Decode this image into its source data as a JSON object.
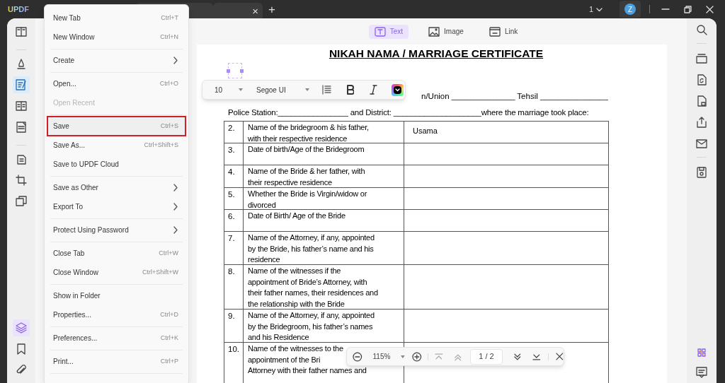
{
  "title_bar": {
    "logo": "UPDF",
    "tab_close": "×",
    "new_tab": "+",
    "page_count": "1",
    "avatar": "Z"
  },
  "left_tools": [
    {
      "selected": false
    },
    {
      "selected": false
    },
    {
      "selected": true
    },
    {
      "selected": false
    },
    {
      "selected": false
    },
    {
      "selected": false
    },
    {
      "selected": false
    },
    {
      "selected": false
    }
  ],
  "bottom_tools": [
    {
      "selected": true
    },
    {
      "selected": false
    },
    {
      "selected": false
    }
  ],
  "mode_tabs": [
    {
      "label": "Text",
      "selected": true
    },
    {
      "label": "Image",
      "selected": false
    },
    {
      "label": "Link",
      "selected": false
    }
  ],
  "document": {
    "title": "NIKAH NAMA / MARRIAGE CERTIFICATE",
    "partial_line": "n/Union ______________ Tehsil _______________",
    "police_line": "Police Station:________________ and District: ____________________where the marriage took place:",
    "rows": [
      {
        "number": "2.",
        "label_lines": [
          "Name of the bridegroom & his father,",
          "with their respective residence"
        ],
        "value": "Usama"
      },
      {
        "number": "3.",
        "label_lines": [
          "Date of birth/Age of the Bridegroom"
        ]
      },
      {
        "number": "4.",
        "label_lines": [
          "Name of  the Bride & her father, with",
          "their respective residence"
        ]
      },
      {
        "number": "5.",
        "label_lines": [
          "Whether the Bride is Virgin/widow or",
          "divorced"
        ]
      },
      {
        "number": "6.",
        "label_lines": [
          "Date of Birth/ Age of the Bride"
        ]
      },
      {
        "number": "7.",
        "label_lines": [
          "Name of  the Attorney, if any, appointed",
          "by the Bride, his father’s name and his",
          "residence"
        ]
      },
      {
        "number": "8.",
        "label_lines": [
          "Name of the witnesses if the",
          "appointment of Bride’s Attorney, with",
          "their father  names, their residences and",
          "the relationship with the Bride"
        ]
      },
      {
        "number": "9.",
        "label_lines": [
          "Name of the Attorney, if any, appointed",
          "by the  Bridegroom, his father’s names",
          "and his Residence"
        ]
      },
      {
        "number": "10.",
        "label_lines": [
          "Name of the witnesses to the",
          "appointment  of the Bri",
          "Attorney with their father names and"
        ]
      }
    ]
  },
  "text_toolbar": {
    "font_size": "10",
    "font": "Segoe UI"
  },
  "file_menu": {
    "entries": [
      {
        "kind": "item",
        "label": "New Tab",
        "shortcut": "Ctrl+T",
        "submenu": false,
        "disabled": false,
        "selected": false
      },
      {
        "kind": "item",
        "label": "New Window",
        "shortcut": "Ctrl+N",
        "submenu": false,
        "disabled": false,
        "selected": false
      },
      {
        "kind": "separator"
      },
      {
        "kind": "item",
        "label": "Create",
        "submenu": true,
        "disabled": false,
        "selected": false
      },
      {
        "kind": "separator"
      },
      {
        "kind": "item",
        "label": "Open...",
        "shortcut": "Ctrl+O",
        "submenu": false,
        "disabled": false,
        "selected": false
      },
      {
        "kind": "item",
        "label": "Open Recent",
        "submenu": false,
        "disabled": true,
        "selected": false
      },
      {
        "kind": "separator"
      },
      {
        "kind": "item",
        "label": "Save",
        "shortcut": "Ctrl+S",
        "submenu": false,
        "disabled": false,
        "selected": true
      },
      {
        "kind": "item",
        "label": "Save As...",
        "shortcut": "Ctrl+Shift+S",
        "submenu": false,
        "disabled": false,
        "selected": false
      },
      {
        "kind": "item",
        "label": "Save to UPDF Cloud",
        "submenu": false,
        "disabled": false,
        "selected": false
      },
      {
        "kind": "separator"
      },
      {
        "kind": "item",
        "label": "Save as Other",
        "submenu": true,
        "disabled": false,
        "selected": false
      },
      {
        "kind": "item",
        "label": "Export To",
        "submenu": true,
        "disabled": false,
        "selected": false
      },
      {
        "kind": "separator"
      },
      {
        "kind": "item",
        "label": "Protect Using Password",
        "submenu": true,
        "disabled": false,
        "selected": false
      },
      {
        "kind": "separator"
      },
      {
        "kind": "item",
        "label": "Close Tab",
        "shortcut": "Ctrl+W",
        "submenu": false,
        "disabled": false,
        "selected": false
      },
      {
        "kind": "item",
        "label": "Close Window",
        "shortcut": "Ctrl+Shift+W",
        "submenu": false,
        "disabled": false,
        "selected": false
      },
      {
        "kind": "separator"
      },
      {
        "kind": "item",
        "label": "Show in Folder",
        "submenu": false,
        "disabled": false,
        "selected": false
      },
      {
        "kind": "item",
        "label": "Properties...",
        "shortcut": "Ctrl+D",
        "submenu": false,
        "disabled": false,
        "selected": false
      },
      {
        "kind": "separator"
      },
      {
        "kind": "item",
        "label": "Preferences...",
        "shortcut": "Ctrl+K",
        "submenu": false,
        "disabled": false,
        "selected": false
      },
      {
        "kind": "separator"
      },
      {
        "kind": "item",
        "label": "Print...",
        "shortcut": "Ctrl+P",
        "submenu": false,
        "disabled": false,
        "selected": false
      },
      {
        "kind": "separator"
      }
    ]
  },
  "zoom_bar": {
    "zoom": "115%",
    "page": "1 / 2"
  }
}
